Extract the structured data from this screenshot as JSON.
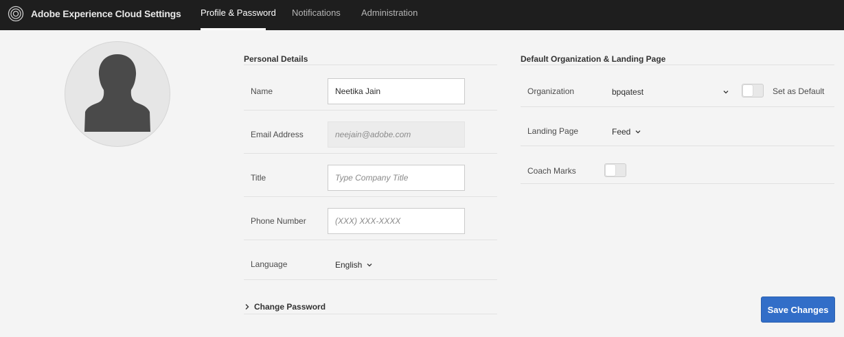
{
  "app": {
    "title": "Adobe Experience Cloud Settings",
    "logo_icon": "adobe-experience-cloud-icon"
  },
  "nav": {
    "tabs": [
      {
        "label": "Profile & Password",
        "active": true
      },
      {
        "label": "Notifications",
        "active": false
      },
      {
        "label": "Administration",
        "active": false
      }
    ]
  },
  "avatar": {
    "icon": "user-silhouette-icon"
  },
  "personal": {
    "heading": "Personal Details",
    "name": {
      "label": "Name",
      "value": "Neetika Jain"
    },
    "email": {
      "label": "Email Address",
      "placeholder": "neejain@adobe.com"
    },
    "title": {
      "label": "Title",
      "placeholder": "Type Company Title"
    },
    "phone": {
      "label": "Phone Number",
      "placeholder": "(XXX) XXX-XXXX"
    },
    "language": {
      "label": "Language",
      "value": "English"
    },
    "change_password": "Change Password"
  },
  "defaults": {
    "heading": "Default Organization & Landing Page",
    "organization": {
      "label": "Organization",
      "value": "bpqatest",
      "set_default_label": "Set as Default",
      "set_default_on": false
    },
    "landing_page": {
      "label": "Landing Page",
      "value": "Feed"
    },
    "coach_marks": {
      "label": "Coach Marks",
      "on": false
    }
  },
  "actions": {
    "save_label": "Save Changes"
  },
  "colors": {
    "topbar": "#1e1e1e",
    "accent": "#326ec8",
    "background": "#f4f4f4"
  }
}
